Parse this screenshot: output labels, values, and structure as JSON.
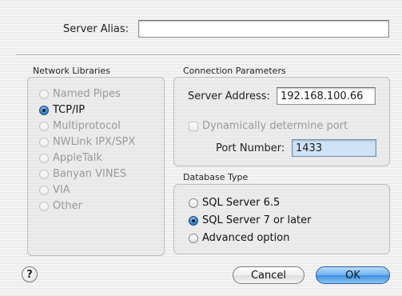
{
  "server_alias": {
    "label": "Server Alias:",
    "value": ""
  },
  "network_libraries": {
    "title": "Network Libraries",
    "options": [
      {
        "label": "Named Pipes",
        "selected": false,
        "enabled": false
      },
      {
        "label": "TCP/IP",
        "selected": true,
        "enabled": true
      },
      {
        "label": "Multiprotocol",
        "selected": false,
        "enabled": false
      },
      {
        "label": "NWLink IPX/SPX",
        "selected": false,
        "enabled": false
      },
      {
        "label": "AppleTalk",
        "selected": false,
        "enabled": false
      },
      {
        "label": "Banyan VINES",
        "selected": false,
        "enabled": false
      },
      {
        "label": "VIA",
        "selected": false,
        "enabled": false
      },
      {
        "label": "Other",
        "selected": false,
        "enabled": false
      }
    ]
  },
  "connection_parameters": {
    "title": "Connection Parameters",
    "server_address_label": "Server Address:",
    "server_address_value": "192.168.100.66",
    "dynamic_port_label": "Dynamically determine port",
    "dynamic_port_checked": false,
    "port_number_label": "Port Number:",
    "port_number_value": "1433"
  },
  "database_type": {
    "title": "Database Type",
    "options": [
      {
        "label": "SQL Server 6.5",
        "selected": false
      },
      {
        "label": "SQL Server 7 or later",
        "selected": true
      },
      {
        "label": "Advanced option",
        "selected": false
      }
    ]
  },
  "buttons": {
    "help_label": "?",
    "cancel_label": "Cancel",
    "ok_label": "OK"
  },
  "colors": {
    "accent": "#4a8fd8",
    "field_focus": "#cfe3f6",
    "disabled_text": "#9a9a9a"
  }
}
